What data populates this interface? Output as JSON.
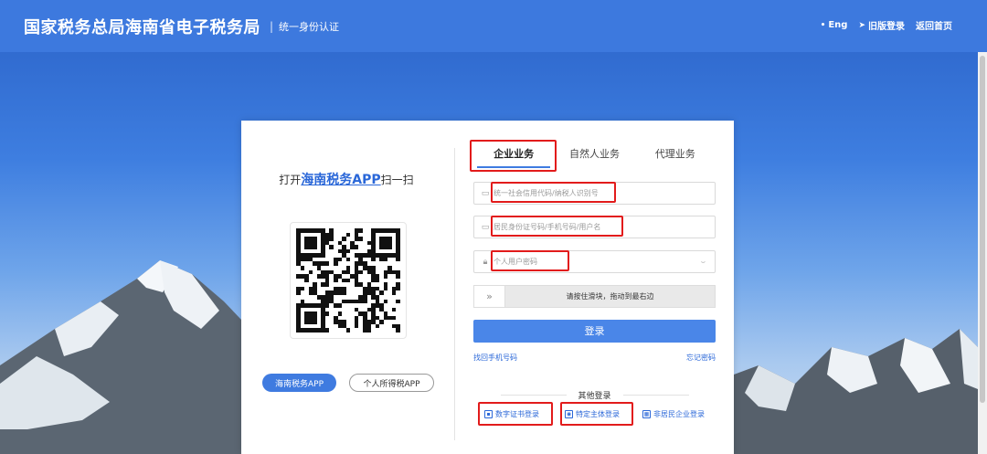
{
  "header": {
    "title": "国家税务总局海南省电子税务局",
    "separator": "|",
    "subtitle": "统一身份认证",
    "links": [
      {
        "label": "Eng",
        "icon": "globe-icon",
        "glyph": "•"
      },
      {
        "label": "旧版登录",
        "icon": "send-icon",
        "glyph": "➤"
      },
      {
        "label": "返回首页",
        "icon": "",
        "glyph": ""
      }
    ]
  },
  "left_panel": {
    "scan_prefix": "打开",
    "scan_app": "海南税务APP",
    "scan_suffix": "扫一扫",
    "app_buttons": [
      "海南税务APP",
      "个人所得税APP"
    ]
  },
  "tabs": [
    "企业业务",
    "自然人业务",
    "代理业务"
  ],
  "form": {
    "credit_code_placeholder": "统一社会信用代码/纳税人识别号",
    "username_placeholder": "居民身份证号码/手机号码/用户名",
    "password_placeholder": "个人用户密码",
    "slider_text": "请按住滑块，拖动到最右边",
    "slider_glyph": "»",
    "login_label": "登录",
    "find_phone": "找回手机号码",
    "forgot_password": "忘记密码"
  },
  "other_login": {
    "label": "其他登录",
    "options": [
      {
        "label": "数字证书登录",
        "icon": "certificate-icon"
      },
      {
        "label": "特定主体登录",
        "icon": "camera-icon"
      },
      {
        "label": "非居民企业登录",
        "icon": "enterprise-icon"
      }
    ]
  },
  "colors": {
    "header_bg": "#3d79de",
    "primary": "#4a86e8",
    "link": "#2a67d8",
    "highlight": "#e21b1b"
  }
}
